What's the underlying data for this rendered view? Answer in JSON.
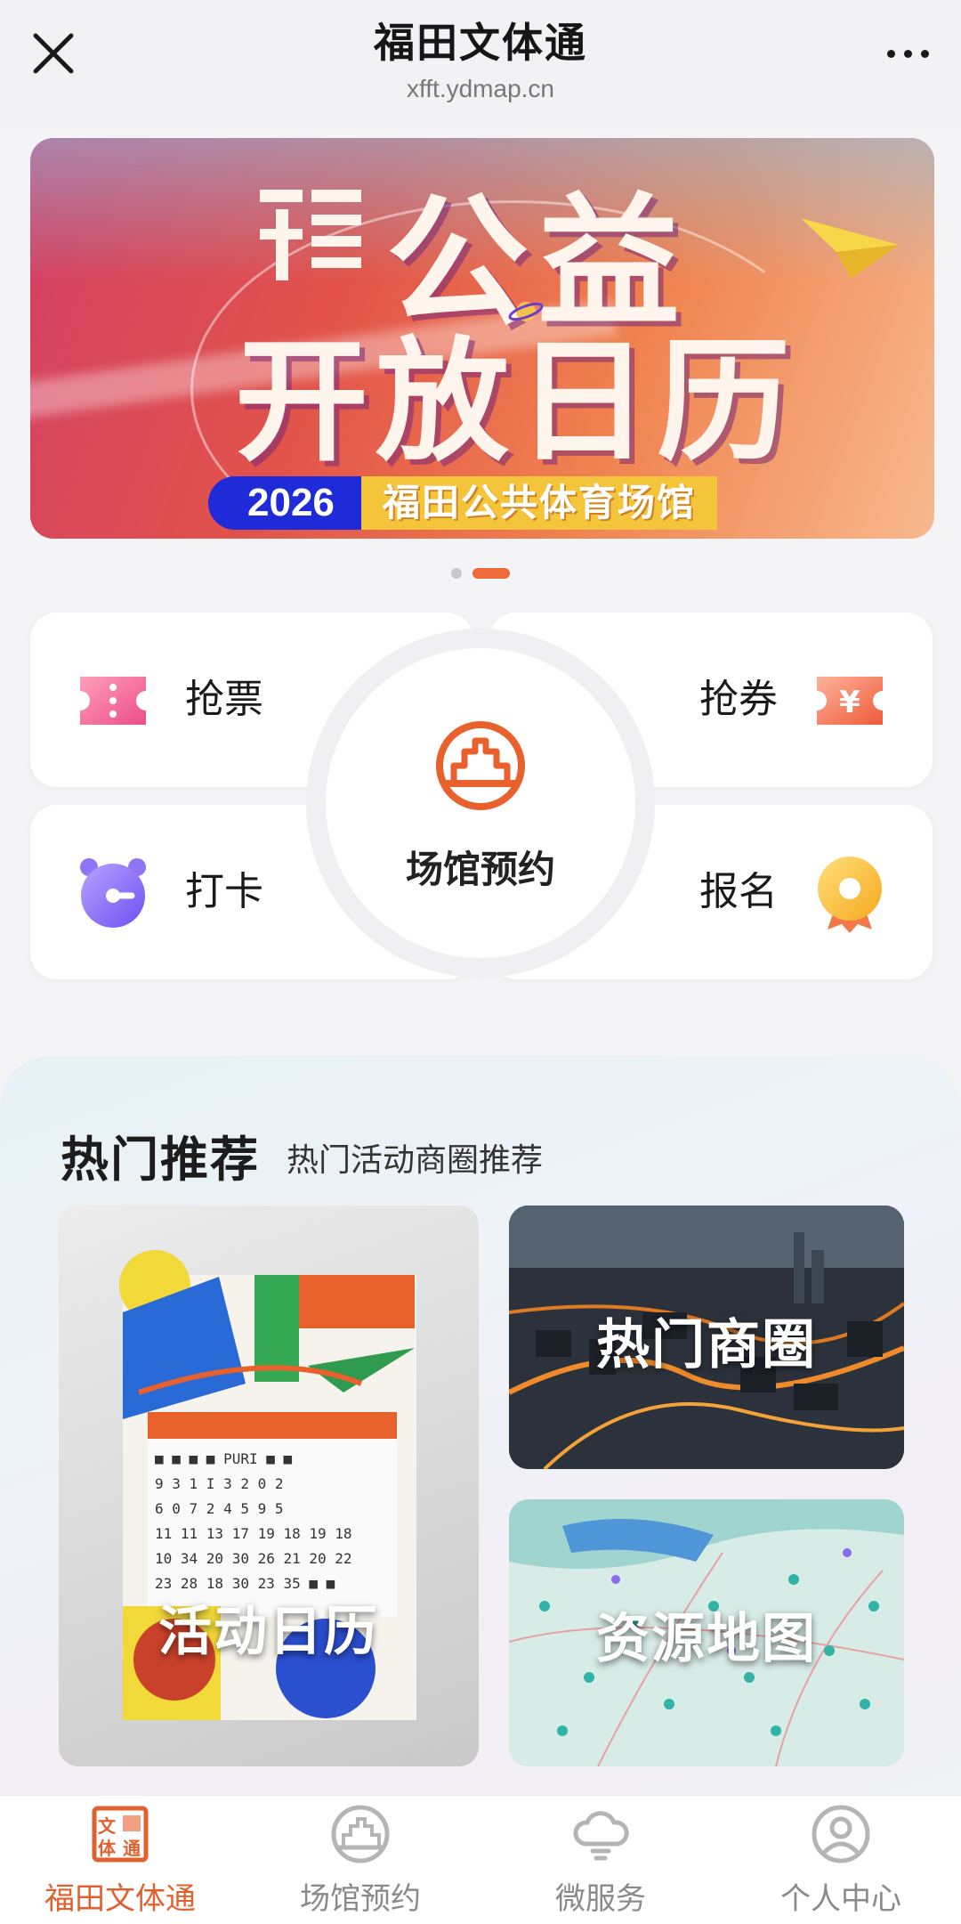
{
  "header": {
    "title": "福田文体通",
    "subtitle": "xfft.ydmap.cn",
    "close_icon": "close-icon",
    "more_icon": "more-dots-icon"
  },
  "banner": {
    "title_line1": "公益",
    "title_line2": "开放日历",
    "year": "2026",
    "venue": "福田公共体育场馆",
    "page_count": 2,
    "active_page": 2
  },
  "services": {
    "tickets": {
      "label": "抢票",
      "icon": "ticket-icon"
    },
    "coupons": {
      "label": "抢券",
      "icon": "coupon-icon"
    },
    "checkin": {
      "label": "打卡",
      "icon": "alarm-clock-icon"
    },
    "signup": {
      "label": "报名",
      "icon": "medal-icon"
    },
    "venue_booking": {
      "label": "场馆预约",
      "icon": "stadium-icon"
    }
  },
  "hot": {
    "title": "热门推荐",
    "subtitle": "热门活动商圈推荐",
    "tiles": [
      {
        "label": "活动日历"
      },
      {
        "label": "热门商圈"
      },
      {
        "label": "资源地图"
      }
    ]
  },
  "tabs": [
    {
      "label": "福田文体通",
      "icon": "home-logo-icon",
      "active": true
    },
    {
      "label": "场馆预约",
      "icon": "stadium-icon",
      "active": false
    },
    {
      "label": "微服务",
      "icon": "cloud-icon",
      "active": false
    },
    {
      "label": "个人中心",
      "icon": "user-icon",
      "active": false
    }
  ],
  "colors": {
    "accent": "#e0612e",
    "banner_blue": "#1f2bd8",
    "banner_yellow": "#f4c43a"
  }
}
